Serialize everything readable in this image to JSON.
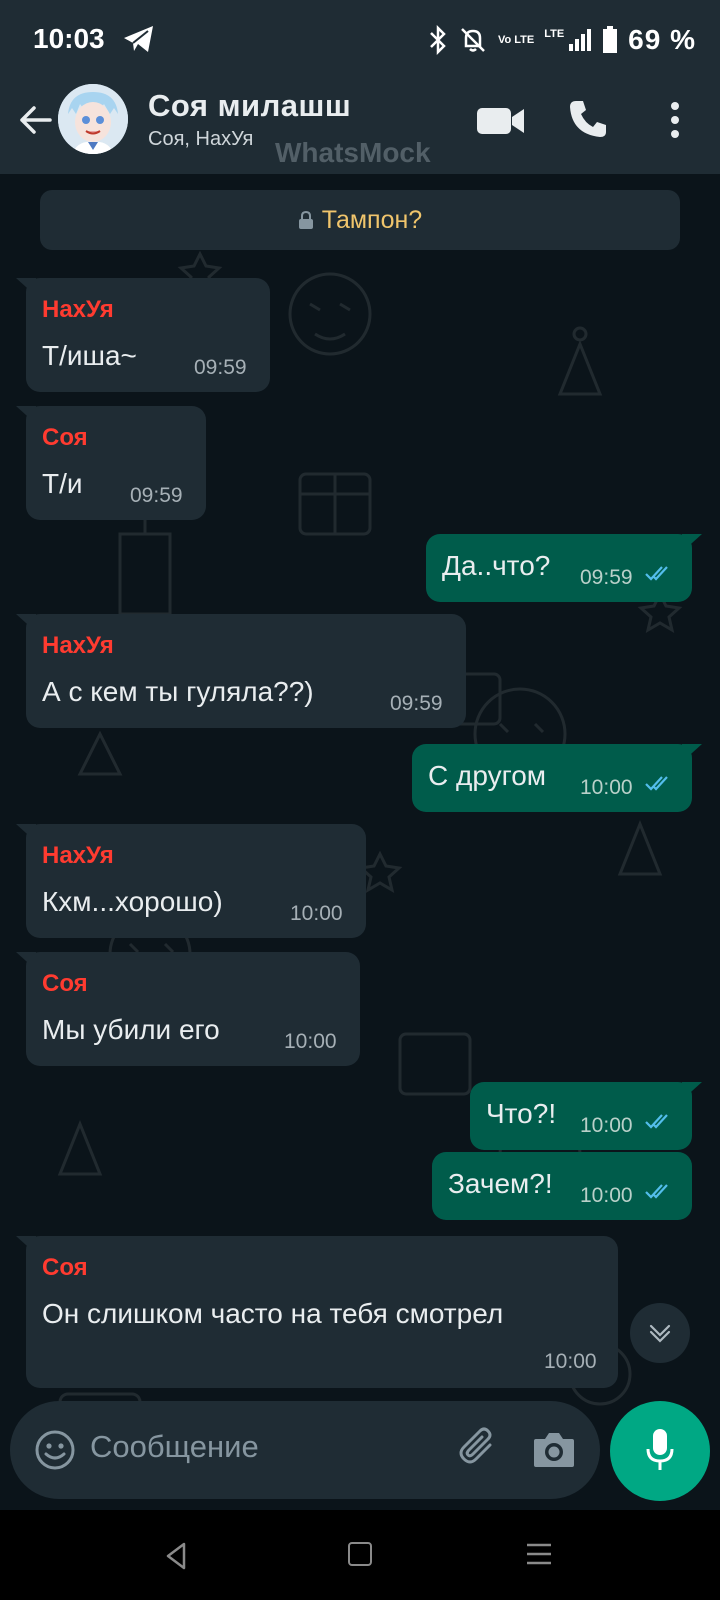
{
  "status_bar": {
    "time": "10:03",
    "volte": "Vo LTE",
    "lte": "LTE",
    "battery": "69 %"
  },
  "header": {
    "title": "Соя милашш",
    "subtitle": "Соя, НахУя",
    "watermark": "WhatsMock"
  },
  "system_message": {
    "text": "Тампон?"
  },
  "messages": [
    {
      "direction": "in",
      "sender": "НахУя",
      "text": "Т/иша~",
      "time": "09:59"
    },
    {
      "direction": "in",
      "sender": "Соя",
      "text": "Т/и",
      "time": "09:59"
    },
    {
      "direction": "out",
      "text": "Да..что?",
      "time": "09:59",
      "status": "read"
    },
    {
      "direction": "in",
      "sender": "НахУя",
      "text": "А с кем ты гуляла??)",
      "time": "09:59"
    },
    {
      "direction": "out",
      "text": "С другом",
      "time": "10:00",
      "status": "read"
    },
    {
      "direction": "in",
      "sender": "НахУя",
      "text": "Кхм...хорошо)",
      "time": "10:00"
    },
    {
      "direction": "in",
      "sender": "Соя",
      "text": "Мы убили его",
      "time": "10:00"
    },
    {
      "direction": "out",
      "text": "Что?!",
      "time": "10:00",
      "status": "read"
    },
    {
      "direction": "out",
      "text": "Зачем?!",
      "time": "10:00",
      "status": "read"
    },
    {
      "direction": "in",
      "sender": "Соя",
      "text": "Он слишком часто на тебя смотрел",
      "time": "10:00"
    }
  ],
  "input": {
    "placeholder": "Сообщение"
  },
  "colors": {
    "background": "#0b141a",
    "header": "#1f2c34",
    "incoming_bubble": "#1f2c34",
    "outgoing_bubble": "#005c4b",
    "sender_name": "#ff3b30",
    "system_text": "#f0c56c",
    "read_ticks": "#53bdeb",
    "mic_button": "#00a884"
  },
  "icons": [
    "telegram-icon",
    "bluetooth-icon",
    "mute-icon",
    "signal-icon",
    "battery-icon",
    "back-arrow-icon",
    "video-call-icon",
    "voice-call-icon",
    "more-options-icon",
    "lock-icon",
    "double-check-icon",
    "chevron-down-icon",
    "emoji-icon",
    "attach-icon",
    "camera-icon",
    "mic-icon"
  ]
}
